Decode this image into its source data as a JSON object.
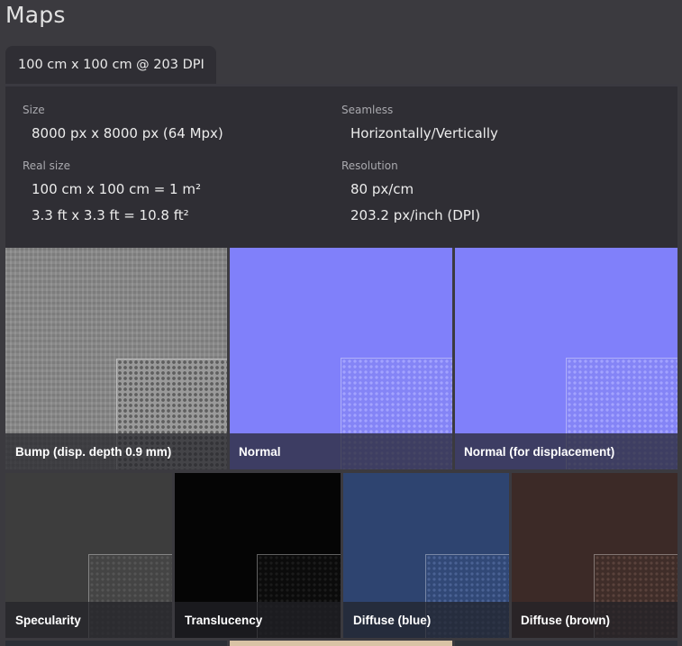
{
  "section_title": "Maps",
  "tab_label": "100 cm x 100 cm @ 203 DPI",
  "info": {
    "size_label": "Size",
    "size_value": "8000 px x 8000 px (64 Mpx)",
    "seamless_label": "Seamless",
    "seamless_value": "Horizontally/Vertically",
    "real_size_label": "Real size",
    "real_size_metric": "100 cm x 100 cm = 1 m²",
    "real_size_imperial": "3.3 ft x 3.3 ft = 10.8 ft²",
    "resolution_label": "Resolution",
    "resolution_metric": "80 px/cm",
    "resolution_dpi": "203.2 px/inch (DPI)"
  },
  "maps_row1": [
    {
      "name": "Bump (disp. depth 0.9 mm)",
      "color": "#8a8a8a"
    },
    {
      "name": "Normal",
      "color": "#8080fa"
    },
    {
      "name": "Normal (for displacement)",
      "color": "#8080fa"
    }
  ],
  "maps_row2": [
    {
      "name": "Specularity",
      "color": "#3d3d3d"
    },
    {
      "name": "Translucency",
      "color": "#050505"
    },
    {
      "name": "Diffuse (blue)",
      "color": "#2e4470"
    },
    {
      "name": "Diffuse (brown)",
      "color": "#3c2a27"
    }
  ]
}
